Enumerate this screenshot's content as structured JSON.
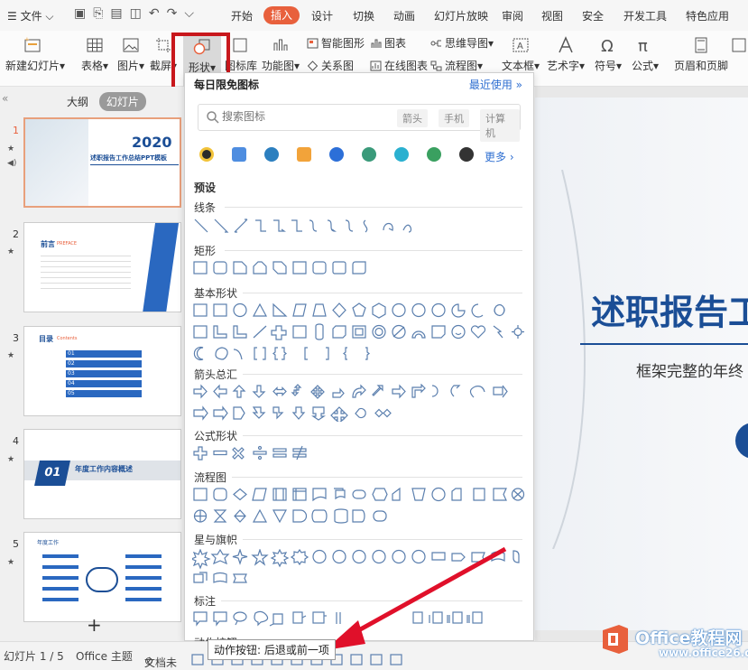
{
  "menubar": {
    "file": "文件",
    "tabs": [
      "开始",
      "插入",
      "设计",
      "切换",
      "动画",
      "幻灯片放映",
      "审阅",
      "视图",
      "安全",
      "开发工具",
      "特色应用"
    ],
    "active_tab": "插入"
  },
  "ribbon": {
    "new_slide": "新建幻灯片",
    "table": "表格",
    "picture": "图片",
    "screenshot": "截屏",
    "shape": "形状",
    "icon_lib": "图标库",
    "func_chart": "功能图",
    "smart_art": "智能图形",
    "chart": "图表",
    "mind_map": "思维导图",
    "relation": "关系图",
    "online_chart": "在线图表",
    "flowchart": "流程图",
    "textbox": "文本框",
    "wordart": "艺术字",
    "symbol": "符号",
    "formula": "公式",
    "header_footer": "页眉和页脚"
  },
  "left_pane": {
    "tab_outline": "大纲",
    "tab_slides": "幻灯片",
    "slides": [
      {
        "num": "1",
        "title": "述职报告工作总结PPT模板",
        "year": "2020"
      },
      {
        "num": "2",
        "title": "前言",
        "subtitle": "PREFACE"
      },
      {
        "num": "3",
        "title": "目录",
        "subtitle": "Contents",
        "items": [
          "01",
          "02",
          "03",
          "04",
          "05"
        ]
      },
      {
        "num": "4",
        "title": "年度工作内容概述",
        "badge": "01"
      },
      {
        "num": "5",
        "title": "年度工作"
      }
    ]
  },
  "dropdown": {
    "header": "每日限免图标",
    "recent": "最近使用",
    "search_placeholder": "搜索图标",
    "tags": [
      "箭头",
      "手机",
      "计算机"
    ],
    "more": "更多",
    "preset": "预设",
    "sections": [
      "线条",
      "矩形",
      "基本形状",
      "箭头总汇",
      "公式形状",
      "流程图",
      "星与旗帜",
      "标注",
      "动作按钮"
    ],
    "icon_colors": [
      "#2a2a2a",
      "#4e8de0",
      "#2c7fbf",
      "#f2a33a",
      "#2c6fd8",
      "#3a9a7a",
      "#2ab0d0",
      "#3aa060",
      "#333333"
    ]
  },
  "tooltip": "动作按钮: 后退或前一项",
  "canvas": {
    "title": "述职报告工",
    "subtitle": "框架完整的年终"
  },
  "statusbar": {
    "slide_count": "幻灯片 1 / 5",
    "theme": "Office 主题",
    "doc": "文档未"
  },
  "watermark": {
    "name": "Office教程网",
    "url": "www.office26.com"
  },
  "colors": {
    "accent": "#e8603c",
    "highlight": "#c8171c",
    "brand_blue": "#1b4e96",
    "link": "#2f6fd1"
  }
}
